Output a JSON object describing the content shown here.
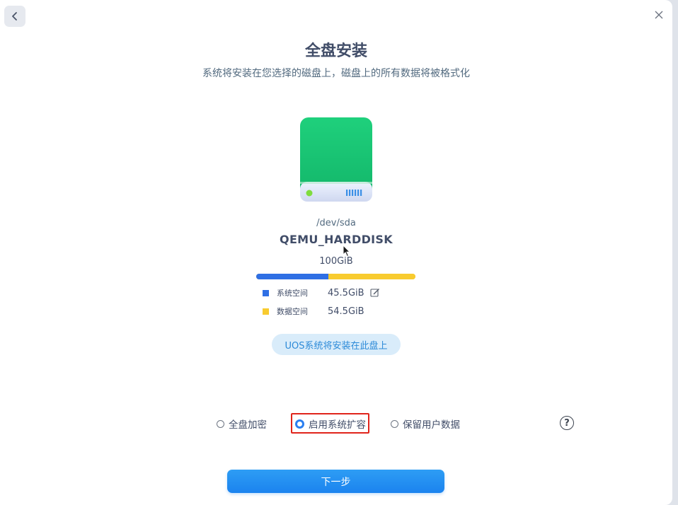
{
  "window": {
    "back_icon": "chevron-left-icon",
    "close_icon": "close-icon"
  },
  "header": {
    "title": "全盘安装",
    "subtitle": "系统将安装在您选择的磁盘上，磁盘上的所有数据将被格式化"
  },
  "disk": {
    "icon": "hard-disk-icon",
    "path": "/dev/sda",
    "name": "QEMU_HARDDISK",
    "size": "100GiB",
    "usage": {
      "system": {
        "label": "系统空间",
        "value": "45.5GiB",
        "color": "#2f6fe4",
        "fraction": 0.455
      },
      "data": {
        "label": "数据空间",
        "value": "54.5GiB",
        "color": "#f8cb2f",
        "fraction": 0.545
      }
    },
    "install_label": "UOS系统将安装在此盘上"
  },
  "options": [
    {
      "label": "全盘加密",
      "checked": false
    },
    {
      "label": "启用系统扩容",
      "checked": true
    },
    {
      "label": "保留用户数据",
      "checked": false
    }
  ],
  "help_icon": "question-circle-icon",
  "footer": {
    "next_label": "下一步"
  },
  "colors": {
    "accent": "#1b83ef",
    "highlight": "#e0241b"
  }
}
